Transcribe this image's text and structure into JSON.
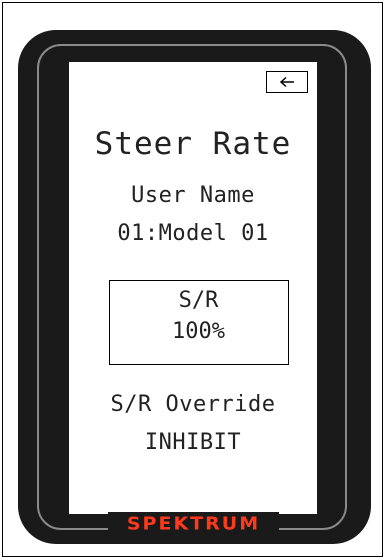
{
  "screen": {
    "back_button_icon": "back-arrow-icon",
    "title": "Steer Rate",
    "user_name_label": "User Name",
    "model_name": "01:Model 01",
    "value_box": {
      "label": "S/R",
      "value": "100%"
    },
    "override_label": "S/R Override",
    "override_value": "INHIBIT"
  },
  "device": {
    "brand": "SPEKTRUM",
    "brand_color": "#ff3a1c",
    "body_color": "#1a1a1a"
  }
}
